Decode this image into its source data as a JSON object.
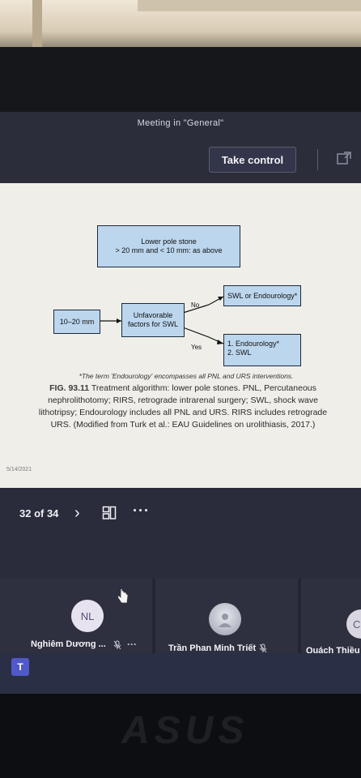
{
  "header": {
    "meeting_title": "Meeting in \"General\"",
    "take_control_label": "Take control"
  },
  "slide": {
    "box_lower_line1": "Lower pole stone",
    "box_lower_line2": "> 20 mm and < 10 mm: as above",
    "box_size": "10–20 mm",
    "box_unfav_line1": "Unfavorable",
    "box_unfav_line2": "factors for SWL",
    "label_no": "No",
    "label_yes": "Yes",
    "box_swl": "SWL or Endourology*",
    "box_endo_line1": "1. Endourology*",
    "box_endo_line2": "2. SWL",
    "footnote": "*The term 'Endourology' encompasses all PNL and URS interventions.",
    "fig_number": "FIG. 93.11",
    "caption": "Treatment algorithm: lower pole stones. PNL, Percutaneous nephrolithotomy; RIRS, retrograde intrarenal surgery; SWL, shock wave lithotripsy; Endourology includes all PNL and URS. RIRS includes retrograde URS. (Modified from Turk et al.: EAU Guidelines on urolithiasis, 2017.)",
    "slide_date": "5/14/2021"
  },
  "navigation": {
    "slide_counter": "32 of 34",
    "next_glyph": "›",
    "more_glyph": "···"
  },
  "participants": [
    {
      "initials": "NL",
      "name": "Nghiêm Dương ...",
      "muted": true
    },
    {
      "initials": "",
      "name": "Trần Phan Minh Triết",
      "muted": true
    },
    {
      "initials": "C",
      "name": "Quách Thiều",
      "muted": false
    }
  ],
  "taskbar": {
    "teams_icon_label": "T"
  },
  "device": {
    "brand": "ASUS"
  },
  "icons": [
    "popout-icon",
    "next-icon",
    "grid-view-icon",
    "more-options-icon",
    "mic-muted-icon",
    "teams-icon",
    "cursor-icon"
  ]
}
